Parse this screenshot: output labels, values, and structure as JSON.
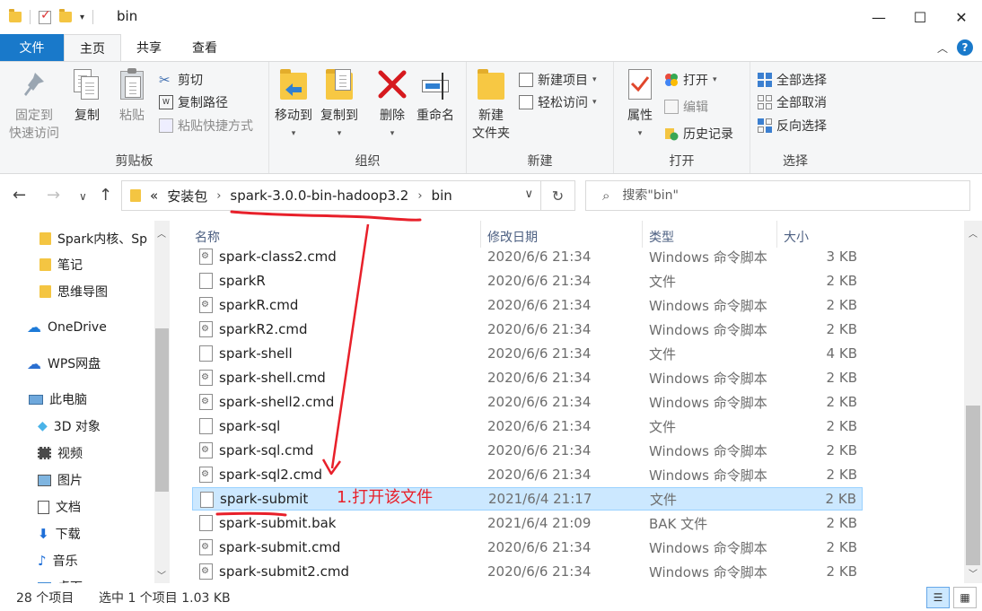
{
  "window": {
    "title": "bin",
    "qat_arrow": "▾",
    "minimize": "—",
    "maximize": "☐",
    "close": "✕"
  },
  "ribbon_tabs": [
    {
      "label": "文件"
    },
    {
      "label": "主页"
    },
    {
      "label": "共享"
    },
    {
      "label": "查看"
    }
  ],
  "ribbon": {
    "clipboard": {
      "label": "剪贴板",
      "pin": "固定到",
      "pin2": "快速访问",
      "copy": "复制",
      "paste": "粘贴",
      "cut": "剪切",
      "copy_path": "复制路径",
      "paste_shortcut": "粘贴快捷方式"
    },
    "organize": {
      "label": "组织",
      "move_to": "移动到",
      "copy_to": "复制到",
      "delete": "删除",
      "rename": "重命名"
    },
    "new": {
      "label": "新建",
      "new_folder": "新建",
      "new_folder2": "文件夹",
      "new_item": "新建项目",
      "easy_access": "轻松访问"
    },
    "open": {
      "label": "打开",
      "properties": "属性",
      "open": "打开",
      "edit": "编辑",
      "history": "历史记录"
    },
    "select": {
      "label": "选择",
      "select_all": "全部选择",
      "select_none": "全部取消",
      "invert": "反向选择"
    }
  },
  "address": {
    "overflow": "«",
    "crumbs": [
      "安装包",
      "spark-3.0.0-bin-hadoop3.2",
      "bin"
    ],
    "sep": "›"
  },
  "search": {
    "placeholder": "搜索\"bin\""
  },
  "nav": {
    "items": [
      {
        "label": "Spark内核、Sp"
      },
      {
        "label": "笔记"
      },
      {
        "label": "思维导图"
      },
      {
        "label": "OneDrive"
      },
      {
        "label": "WPS网盘"
      },
      {
        "label": "此电脑"
      },
      {
        "label": "3D 对象"
      },
      {
        "label": "视频"
      },
      {
        "label": "图片"
      },
      {
        "label": "文档"
      },
      {
        "label": "下载"
      },
      {
        "label": "音乐"
      },
      {
        "label": "桌面"
      }
    ]
  },
  "columns": {
    "name": "名称",
    "date": "修改日期",
    "type": "类型",
    "size": "大小"
  },
  "files": [
    {
      "name": "spark-class2.cmd",
      "date": "2020/6/6 21:34",
      "type": "Windows 命令脚本",
      "size": "3 KB",
      "kind": "cmd"
    },
    {
      "name": "sparkR",
      "date": "2020/6/6 21:34",
      "type": "文件",
      "size": "2 KB",
      "kind": "file"
    },
    {
      "name": "sparkR.cmd",
      "date": "2020/6/6 21:34",
      "type": "Windows 命令脚本",
      "size": "2 KB",
      "kind": "cmd"
    },
    {
      "name": "sparkR2.cmd",
      "date": "2020/6/6 21:34",
      "type": "Windows 命令脚本",
      "size": "2 KB",
      "kind": "cmd"
    },
    {
      "name": "spark-shell",
      "date": "2020/6/6 21:34",
      "type": "文件",
      "size": "4 KB",
      "kind": "file"
    },
    {
      "name": "spark-shell.cmd",
      "date": "2020/6/6 21:34",
      "type": "Windows 命令脚本",
      "size": "2 KB",
      "kind": "cmd"
    },
    {
      "name": "spark-shell2.cmd",
      "date": "2020/6/6 21:34",
      "type": "Windows 命令脚本",
      "size": "2 KB",
      "kind": "cmd"
    },
    {
      "name": "spark-sql",
      "date": "2020/6/6 21:34",
      "type": "文件",
      "size": "2 KB",
      "kind": "file"
    },
    {
      "name": "spark-sql.cmd",
      "date": "2020/6/6 21:34",
      "type": "Windows 命令脚本",
      "size": "2 KB",
      "kind": "cmd"
    },
    {
      "name": "spark-sql2.cmd",
      "date": "2020/6/6 21:34",
      "type": "Windows 命令脚本",
      "size": "2 KB",
      "kind": "cmd"
    },
    {
      "name": "spark-submit",
      "date": "2021/6/4 21:17",
      "type": "文件",
      "size": "2 KB",
      "kind": "file",
      "selected": true
    },
    {
      "name": "spark-submit.bak",
      "date": "2021/6/4 21:09",
      "type": "BAK 文件",
      "size": "2 KB",
      "kind": "file"
    },
    {
      "name": "spark-submit.cmd",
      "date": "2020/6/6 21:34",
      "type": "Windows 命令脚本",
      "size": "2 KB",
      "kind": "cmd"
    },
    {
      "name": "spark-submit2.cmd",
      "date": "2020/6/6 21:34",
      "type": "Windows 命令脚本",
      "size": "2 KB",
      "kind": "cmd"
    }
  ],
  "status": {
    "count": "28 个项目",
    "selection": "选中 1 个项目  1.03 KB"
  },
  "annotation": {
    "text": "1.打开该文件",
    "color": "#e8202a"
  },
  "colors": {
    "accent": "#1979ca",
    "selection": "#cce8ff"
  }
}
